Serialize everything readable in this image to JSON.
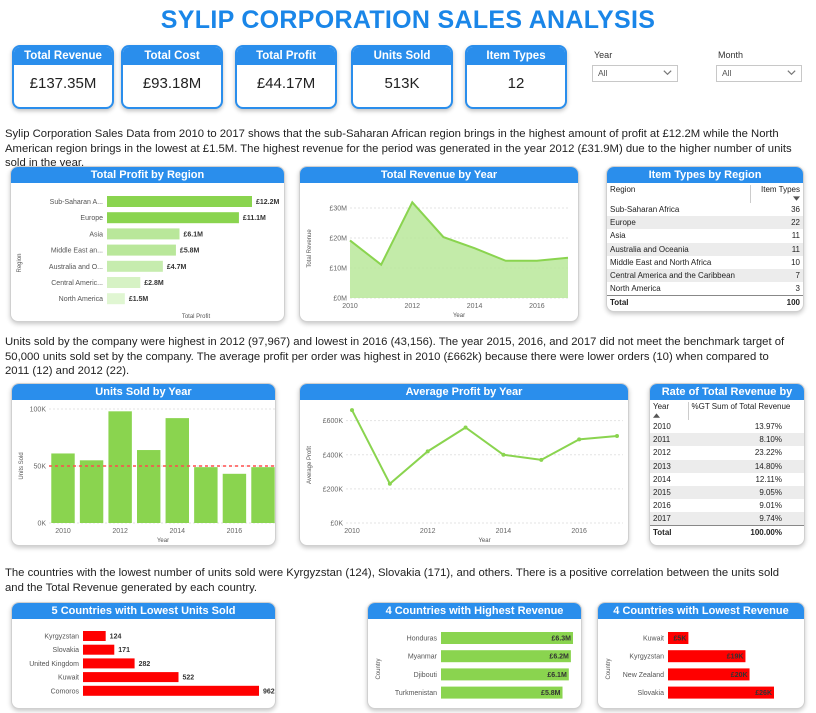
{
  "title": "SYLIP CORPORATION SALES ANALYSIS",
  "kpis": [
    {
      "label": "Total Revenue",
      "value": "£137.35M"
    },
    {
      "label": "Total Cost",
      "value": "£93.18M"
    },
    {
      "label": "Total Profit",
      "value": "£44.17M"
    },
    {
      "label": "Units Sold",
      "value": "513K"
    },
    {
      "label": "Item Types",
      "value": "12"
    }
  ],
  "filters": {
    "year": {
      "label": "Year",
      "value": "All"
    },
    "month": {
      "label": "Month",
      "value": "All"
    }
  },
  "paragraphs": {
    "p1": "Sylip Corporation Sales Data from 2010 to 2017 shows that the sub-Saharan African region brings in the highest amount of profit at £12.2M while the North American region brings in the lowest at £1.5M. The highest revenue for the period was generated in the year 2012 (£31.9M) due to the higher number of units sold in the year.",
    "p2": "Units sold by the company were highest in 2012 (97,967) and lowest in 2016 (43,156). The year 2015, 2016, and 2017 did not meet the benchmark target of 50,000 units sold set by the company. The average profit per order was highest in 2010 (£662k) because there were lower orders (10) when compared to 2011 (12) and 2012 (22).",
    "p3": "The countries with the lowest number of units sold were Kyrgyzstan (124), Slovakia (171), and others. There is a positive correlation between the units sold and the Total Revenue generated by each country."
  },
  "colors": {
    "accent": "#2a8eec",
    "green": "#8ad44f",
    "red": "#ff0000",
    "area": "#b9e79a"
  },
  "chart_data": [
    {
      "id": "profit_region",
      "type": "bar",
      "title": "Total Profit by Region",
      "xlabel": "Total Profit",
      "ylabel": "Region",
      "categories": [
        "Sub-Saharan A...",
        "Europe",
        "Asia",
        "Middle East an...",
        "Australia and O...",
        "Central Americ...",
        "North America"
      ],
      "values": [
        12.2,
        11.1,
        6.1,
        5.8,
        4.7,
        2.8,
        1.5
      ],
      "labels": [
        "£12.2M",
        "£11.1M",
        "£6.1M",
        "£5.8M",
        "£4.7M",
        "£2.8M",
        "£1.5M"
      ],
      "bar_colors": [
        "#8ad44f",
        "#8ad44f",
        "#b9e79a",
        "#b9e79a",
        "#c6ecae",
        "#d6f2c4",
        "#e0f6d2"
      ]
    },
    {
      "id": "revenue_year",
      "type": "area",
      "title": "Total Revenue by Year",
      "xlabel": "Year",
      "ylabel": "Total Revenue",
      "x": [
        2010,
        2011,
        2012,
        2013,
        2014,
        2015,
        2016,
        2017
      ],
      "values": [
        19.2,
        11.1,
        31.9,
        20.3,
        16.6,
        12.4,
        12.4,
        13.4
      ],
      "ylim": [
        0,
        33
      ],
      "yticks": [
        "£0M",
        "£10M",
        "£20M",
        "£30M"
      ],
      "yvals": [
        0,
        10,
        20,
        30
      ],
      "xticks": [
        "2010",
        "2012",
        "2014",
        "2016"
      ],
      "xvals": [
        2010,
        2012,
        2014,
        2016
      ]
    },
    {
      "id": "units_year",
      "type": "bar",
      "title": "Units Sold by Year",
      "xlabel": "Year",
      "ylabel": "Units Sold",
      "x": [
        2010,
        2011,
        2012,
        2013,
        2014,
        2015,
        2016,
        2017
      ],
      "values": [
        61000,
        55000,
        97967,
        64000,
        92000,
        49000,
        43156,
        49000
      ],
      "benchmark": 50000,
      "ylim": [
        0,
        100000
      ],
      "yticks": [
        "0K",
        "50K",
        "100K"
      ],
      "yvals": [
        0,
        50000,
        100000
      ],
      "xticks": [
        "2010",
        "2012",
        "2014",
        "2016"
      ],
      "xvals": [
        2010,
        2012,
        2014,
        2016
      ]
    },
    {
      "id": "avg_profit_year",
      "type": "line",
      "title": "Average Profit by Year",
      "xlabel": "Year",
      "ylabel": "Average Profit",
      "x": [
        2010,
        2011,
        2012,
        2013,
        2014,
        2015,
        2016,
        2017
      ],
      "values": [
        662,
        230,
        420,
        560,
        400,
        370,
        490,
        510
      ],
      "ylim": [
        0,
        680
      ],
      "yticks": [
        "£0K",
        "£200K",
        "£400K",
        "£600K"
      ],
      "yvals": [
        0,
        200,
        400,
        600
      ],
      "xticks": [
        "2010",
        "2012",
        "2014",
        "2016"
      ],
      "xvals": [
        2010,
        2012,
        2014,
        2016
      ]
    },
    {
      "id": "low_units_country",
      "type": "bar",
      "title": "5 Countries with Lowest Units Sold",
      "categories": [
        "Kyrgyzstan",
        "Slovakia",
        "United Kingdom",
        "Kuwait",
        "Comoros"
      ],
      "values": [
        124,
        171,
        282,
        522,
        962
      ],
      "labels": [
        "124",
        "171",
        "282",
        "522",
        "962"
      ]
    },
    {
      "id": "high_revenue_country",
      "type": "bar",
      "title": "4 Countries with Highest Revenue",
      "ylabel": "Country",
      "categories": [
        "Honduras",
        "Myanmar",
        "Djibouti",
        "Turkmenistan"
      ],
      "values": [
        6.3,
        6.2,
        6.1,
        5.8
      ],
      "labels": [
        "£6.3M",
        "£6.2M",
        "£6.1M",
        "£5.8M"
      ]
    },
    {
      "id": "low_revenue_country",
      "type": "bar",
      "title": "4 Countries with Lowest Revenue",
      "ylabel": "Country",
      "categories": [
        "Kuwait",
        "Kyrgyzstan",
        "New Zealand",
        "Slovakia"
      ],
      "values": [
        5,
        19,
        20,
        26
      ],
      "labels": [
        "£5K",
        "£19K",
        "£20K",
        "£26K"
      ]
    }
  ],
  "tables": {
    "item_types": {
      "title": "Item Types by Region",
      "headers": [
        "Region",
        "Item Types"
      ],
      "rows": [
        [
          "Sub-Saharan Africa",
          "36"
        ],
        [
          "Europe",
          "22"
        ],
        [
          "Asia",
          "11"
        ],
        [
          "Australia and Oceania",
          "11"
        ],
        [
          "Middle East and North Africa",
          "10"
        ],
        [
          "Central America and the Caribbean",
          "7"
        ],
        [
          "North America",
          "3"
        ]
      ],
      "total": [
        "Total",
        "100"
      ]
    },
    "rate_revenue": {
      "title": "Rate of Total Revenue by Year",
      "headers": [
        "Year",
        "%GT Sum of Total Revenue"
      ],
      "rows": [
        [
          "2010",
          "13.97%"
        ],
        [
          "2011",
          "8.10%"
        ],
        [
          "2012",
          "23.22%"
        ],
        [
          "2013",
          "14.80%"
        ],
        [
          "2014",
          "12.11%"
        ],
        [
          "2015",
          "9.05%"
        ],
        [
          "2016",
          "9.01%"
        ],
        [
          "2017",
          "9.74%"
        ]
      ],
      "total": [
        "Total",
        "100.00%"
      ]
    }
  }
}
